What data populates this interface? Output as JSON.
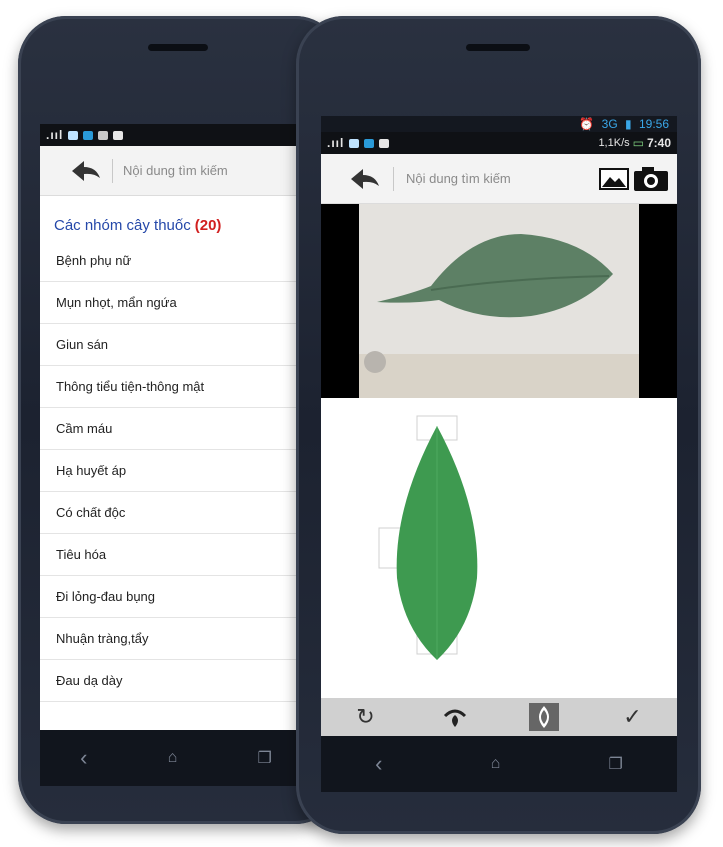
{
  "left_phone": {
    "search": {
      "placeholder": "Nội dung tìm kiếm"
    },
    "group_header": {
      "title": "Các nhóm cây thuốc",
      "count": "(20)"
    },
    "items": [
      "Bệnh phụ nữ",
      "Mụn nhọt, mẩn ngứa",
      "Giun sán",
      "Thông tiểu tiện-thông mật",
      "Cầm máu",
      "Hạ huyết áp",
      "Có chất độc",
      "Tiêu hóa",
      "Đi lỏng-đau bụng",
      "Nhuận tràng,tẩy",
      "Đau dạ dày"
    ]
  },
  "right_phone": {
    "status": {
      "top_time": "19:56",
      "net_speed": "1,1K/s",
      "clock": "7:40",
      "network": "3G"
    },
    "search": {
      "placeholder": "Nội dung tìm kiếm"
    },
    "toolbar_icons": [
      "rotate-icon",
      "leaf-pin-icon",
      "leaf-shape-icon",
      "check-icon"
    ]
  },
  "colors": {
    "accent_blue": "#2548a9",
    "count_red": "#d11f1f",
    "leaf_green": "#3e9a50",
    "toolbar_bg": "#d0d0d0"
  }
}
